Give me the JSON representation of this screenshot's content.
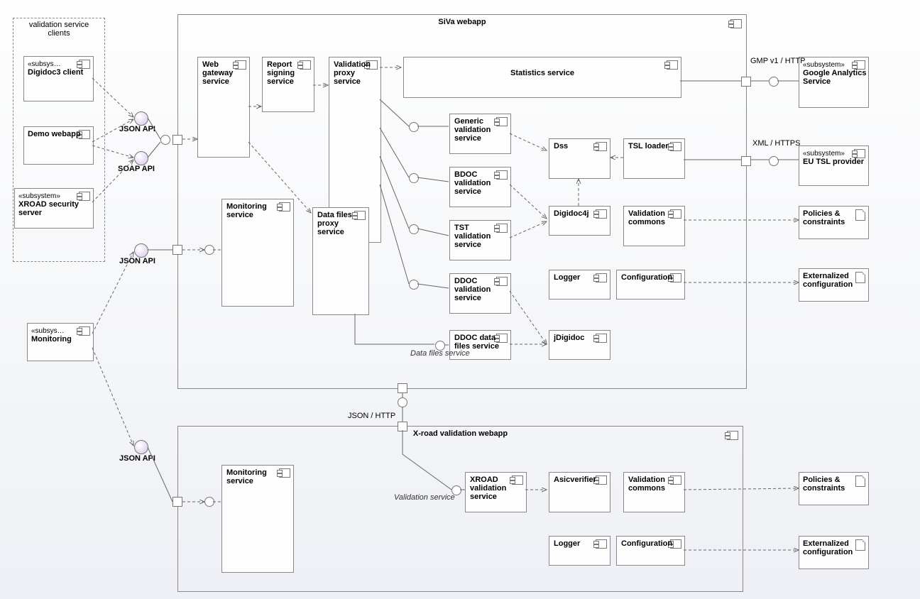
{
  "clients_container": "validation service\nclients",
  "clients": {
    "digidoc3": {
      "stereo": "«subsys…",
      "label": "Digidoc3 client"
    },
    "demo": {
      "label": "Demo webapp"
    },
    "xroad_sec": {
      "stereo": "«subsystem»",
      "label": "XROAD security server"
    },
    "monitoring": {
      "stereo": "«subsys…",
      "label": "Monitoring"
    }
  },
  "api": {
    "json": "JSON API",
    "soap": "SOAP API",
    "json2": "JSON API",
    "json3": "JSON API"
  },
  "siva": {
    "title": "SiVa webapp",
    "web_gw": "Web gateway service",
    "report": "Report signing service",
    "val_proxy": "Validation proxy service",
    "stats": "Statistics service",
    "monitoring": "Monitoring service",
    "data_files_proxy": "Data files proxy service",
    "generic": "Generic validation service",
    "bdoc": "BDOC validation service",
    "tst": "TST validation service",
    "ddoc": "DDOC validation service",
    "ddoc_files": "DDOC data files service",
    "dss": "Dss",
    "tsl_loader": "TSL loader",
    "digidoc4j": "Digidoc4j",
    "val_commons": "Validation commons",
    "logger": "Logger",
    "config": "Configuration",
    "jdigidoc": "jDigidoc"
  },
  "xroad": {
    "title": "X-road validation webapp",
    "monitoring": "Monitoring service",
    "xroad_val": "XROAD validation service",
    "asic": "Asicverifier",
    "val_commons": "Validation commons",
    "logger": "Logger",
    "config": "Configuration"
  },
  "ext": {
    "ga": {
      "stereo": "«subsystem»",
      "label": "Google Analytics Service"
    },
    "eutsl": {
      "stereo": "«subsystem»",
      "label": "EU TSL provider"
    },
    "policies": "Policies & constraints",
    "ext_conf": "Externalized configuration"
  },
  "labels": {
    "gmp": "GMP v1 / HTTP",
    "xml": "XML / HTTPS",
    "json_http": "JSON / HTTP",
    "data_files": "Data files service",
    "val_service": "Validation service"
  }
}
